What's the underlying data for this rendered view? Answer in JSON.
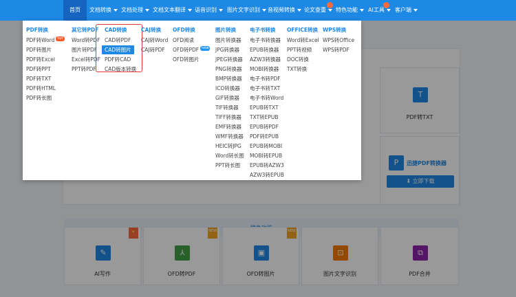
{
  "nav": {
    "items": [
      {
        "label": "首页",
        "active": true
      },
      {
        "label": "文档转换",
        "dropdown": true
      },
      {
        "label": "文档处理",
        "dropdown": true
      },
      {
        "label": "文档文本翻译",
        "dropdown": true
      },
      {
        "label": "语音识别",
        "dropdown": true
      },
      {
        "label": "图片文字识别",
        "dropdown": true
      },
      {
        "label": "音视频转换",
        "dropdown": true
      },
      {
        "label": "论文查重",
        "dropdown": true
      },
      {
        "label": "特色功能",
        "dropdown": true
      },
      {
        "label": "AI工具",
        "dropdown": true
      },
      {
        "label": "客户端",
        "dropdown": true
      }
    ]
  },
  "menu": {
    "columns": [
      {
        "head": "PDF转换",
        "items": [
          "PDF转Word",
          "PDF转图片",
          "PDF转Excel",
          "PDF转PPT",
          "PDF转TXT",
          "PDF转HTML",
          "PDF转长图"
        ],
        "badge_item": 0,
        "badge": "hot"
      },
      {
        "head": "其它转PDF",
        "items": [
          "Word转PDF",
          "图片转PDF",
          "Excel转PDF",
          "PPT转PDF"
        ]
      },
      {
        "head": "CAD转换",
        "items": [
          "CAD转PDF",
          "CAD转图片",
          "PDF转CAD",
          "CAD版本转换"
        ],
        "highlight": 1
      },
      {
        "head": "CAJ转换",
        "items": [
          "CAJ转Word",
          "CAJ转PDF"
        ]
      },
      {
        "head": "OFD转换",
        "items": [
          "OFD阅读",
          "OFD转PDF",
          "OFD转图片"
        ],
        "badge_item": 1,
        "badge": "new"
      },
      {
        "head": "图片转换",
        "items": [
          "图片转换器",
          "JPG转换器",
          "JPEG转换器",
          "PNG转换器",
          "BMP转换器",
          "ICO转换器",
          "GIF转换器",
          "TIF转换器",
          "TIFF转换器",
          "EMF转换器",
          "WMF转换器",
          "HEIC转JPG",
          "Word转长图",
          "PPT转长图"
        ]
      },
      {
        "head": "电子书转换",
        "items": [
          "电子书转换器",
          "EPUB转换器",
          "AZW3转换器",
          "MOBI转换器",
          "电子书转PDF",
          "电子书转TXT",
          "电子书转Word",
          "EPUB转TXT",
          "TXT转EPUB",
          "EPUB转PDF",
          "PDF转EPUB",
          "EPUB转MOBI",
          "MOBI转EPUB",
          "EPUB转AZW3",
          "AZW3转EPUB"
        ]
      },
      {
        "head": "OFFICE转换",
        "items": [
          "Word转Excel",
          "PPT转视频",
          "DOC转换",
          "TXT转换"
        ]
      },
      {
        "head": "WPS转换",
        "items": [
          "WPS转Office",
          "WPS转PDF"
        ]
      }
    ]
  },
  "background": {
    "pdf_txt_label": "PDF转TXT",
    "promo_title": "迅捷PDF转换器",
    "download_label": "立即下载",
    "feature_bar": "特色功能",
    "new_ribbon": "NEW",
    "cards": [
      {
        "label": "AI写作",
        "icon": "pen-icon",
        "color": "#1e88e5"
      },
      {
        "label": "OFD转PDF",
        "icon": "pdf-icon",
        "color": "#43a047"
      },
      {
        "label": "OFD转图片",
        "icon": "image-icon",
        "color": "#1e88e5"
      },
      {
        "label": "图片文字识别",
        "icon": "scan-icon",
        "color": "#f57c00"
      },
      {
        "label": "PDF合并",
        "icon": "merge-icon",
        "color": "#8e24aa"
      }
    ]
  }
}
